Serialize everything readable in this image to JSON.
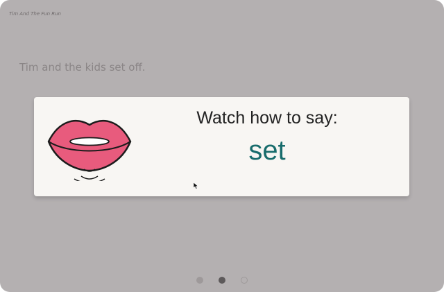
{
  "book": {
    "title": "Tim And The Fun Run"
  },
  "page": {
    "sentence": "Tim and the kids set off."
  },
  "card": {
    "prompt": "Watch how to say:",
    "word": "set",
    "icon": "lips-speaking-icon",
    "word_color": "#186c6c"
  },
  "pager": {
    "total": 3,
    "current": 2
  }
}
